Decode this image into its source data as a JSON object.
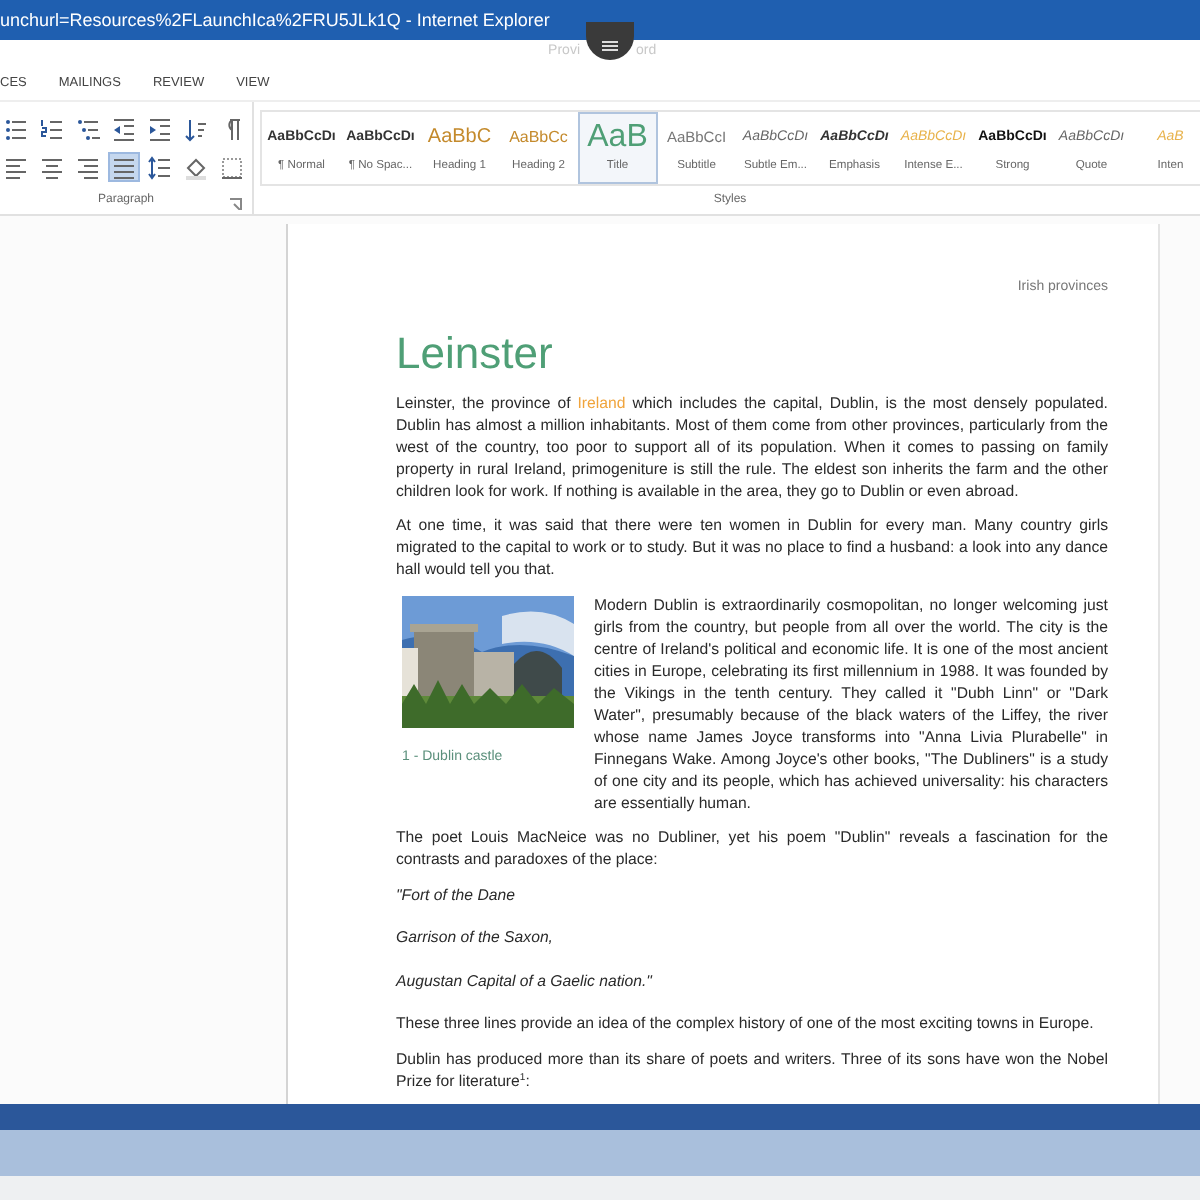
{
  "window": {
    "title": "unchurl=Resources%2FLaunchIca%2FRU5JLk1Q - Internet Explorer"
  },
  "notch": {
    "left_text": "Provi",
    "right_text": "ord"
  },
  "ribbon_tabs": [
    {
      "label": "CES"
    },
    {
      "label": "MAILINGS"
    },
    {
      "label": "REVIEW"
    },
    {
      "label": "VIEW"
    }
  ],
  "paragraph_group": {
    "label": "Paragraph",
    "rows": [
      [
        {
          "kind": "bullets",
          "selected": false
        },
        {
          "kind": "numbering",
          "selected": false
        },
        {
          "kind": "multilevel",
          "selected": false
        },
        {
          "kind": "outdent",
          "selected": false
        },
        {
          "kind": "indent",
          "selected": false
        },
        {
          "kind": "sort",
          "selected": false
        },
        {
          "kind": "pilcrow",
          "selected": false
        }
      ],
      [
        {
          "kind": "align-left",
          "selected": false
        },
        {
          "kind": "align-center",
          "selected": false
        },
        {
          "kind": "align-right",
          "selected": false
        },
        {
          "kind": "justify",
          "selected": true
        },
        {
          "kind": "line-spacing",
          "selected": false
        },
        {
          "kind": "shading",
          "selected": false
        },
        {
          "kind": "borders",
          "selected": false
        }
      ]
    ]
  },
  "styles_gallery": {
    "label": "Styles",
    "items": [
      {
        "kind": "normal",
        "preview": "AaBbCcDı",
        "label": "¶ Normal",
        "selected": false
      },
      {
        "kind": "normal",
        "preview": "AaBbCcDı",
        "label": "¶ No Spac...",
        "selected": false
      },
      {
        "kind": "heading1",
        "preview": "AaBbC",
        "label": "Heading 1",
        "selected": false
      },
      {
        "kind": "heading2",
        "preview": "AaBbCc",
        "label": "Heading 2",
        "selected": false
      },
      {
        "kind": "title",
        "preview": "AaB",
        "label": "Title",
        "selected": true
      },
      {
        "kind": "subtitle",
        "preview": "AaBbCcI",
        "label": "Subtitle",
        "selected": false
      },
      {
        "kind": "subtle",
        "preview": "AaBbCcDı",
        "label": "Subtle Em...",
        "selected": false
      },
      {
        "kind": "emphasis",
        "preview": "AaBbCcDı",
        "label": "Emphasis",
        "selected": false
      },
      {
        "kind": "intense",
        "preview": "AaBbCcDı",
        "label": "Intense E...",
        "selected": false
      },
      {
        "kind": "strong",
        "preview": "AaBbCcDı",
        "label": "Strong",
        "selected": false
      },
      {
        "kind": "subtle",
        "preview": "AaBbCcDı",
        "label": "Quote",
        "selected": false
      },
      {
        "kind": "intense",
        "preview": "AaB",
        "label": "Inten",
        "selected": false
      }
    ]
  },
  "document": {
    "header": "Irish provinces",
    "title": "Leinster",
    "blocks": [
      {
        "kind": "text",
        "runs": [
          {
            "text": "Leinster, the province of "
          },
          {
            "text": "Ireland",
            "link": true
          },
          {
            "text": " which includes the capital, Dublin, is the most densely populated. Dublin has almost a million inhabitants. Most of them come from other provinces, particularly from the west of the country, too poor to support all of its population. When it comes to passing on family property in rural Ireland, primogeniture is still the rule. The eldest son inherits the farm and the other children look for work. If nothing is available in the area, they go to Dublin or even abroad."
          }
        ]
      },
      {
        "kind": "text",
        "runs": [
          {
            "text": "At one time, it was said that there were ten women in Dublin for every man. Many country girls migrated to the capital to work or to study. But it was no place to find a husband: a look into any dance hall would tell you that."
          }
        ]
      },
      {
        "kind": "figure",
        "caption": "1 - Dublin castle"
      },
      {
        "kind": "text",
        "runs": [
          {
            "text": "Modern Dublin is extraordinarily cosmopolitan, no longer welcoming just girls from the country, but people from all over the world. The city is the centre of Ireland's political and economic life. It is one of the most ancient cities in Europe, celebrating its first millennium in 1988. It was founded by the Vikings in the tenth century. They called it \"Dubh Linn\" or \"Dark Water\", presumably because of the black waters of the Liffey, the river whose name James Joyce transforms into \"Anna Livia Plurabelle\" in Finnegans Wake. Among Joyce's other books, \"The Dubliners\" is a study of one city and its people, which has achieved universality: his characters are essentially human."
          }
        ]
      },
      {
        "kind": "text",
        "runs": [
          {
            "text": "The poet Louis MacNeice was no Dubliner, yet his poem \"Dublin\" reveals a fascination for the contrasts and paradoxes of the place:"
          }
        ]
      },
      {
        "kind": "verse",
        "runs": [
          {
            "text": "\"Fort of the Dane"
          }
        ]
      },
      {
        "kind": "verse",
        "runs": [
          {
            "text": "Garrison of the Saxon,"
          }
        ]
      },
      {
        "kind": "verse",
        "runs": [
          {
            "text": "Augustan Capital of a Gaelic nation.\""
          }
        ]
      },
      {
        "kind": "text",
        "runs": [
          {
            "text": "These three lines provide an idea of the complex history of one of the most exciting towns in Europe."
          }
        ]
      },
      {
        "kind": "text",
        "runs": [
          {
            "text": "Dublin has produced more than its share of poets and writers. Three of its sons have won the Nobel Prize for literature$^{1}$:"
          }
        ]
      }
    ]
  }
}
